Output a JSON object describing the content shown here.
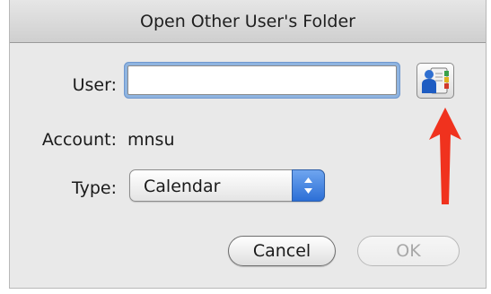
{
  "dialog": {
    "title": "Open Other User's Folder"
  },
  "form": {
    "user_label": "User:",
    "user_value": "",
    "account_label": "Account:",
    "account_value": "mnsu",
    "type_label": "Type:",
    "type_selected": "Calendar"
  },
  "buttons": {
    "cancel_label": "Cancel",
    "ok_label": "OK",
    "ok_enabled": false
  },
  "icons": {
    "pick_user": "address-book-person-icon",
    "select_stepper": "up-down-arrows-icon",
    "annotation": "red-arrow-up-icon"
  },
  "colors": {
    "annotation_arrow": "#f0321e",
    "focus_ring": "#8fb4e0",
    "stepper_blue": "#2c6fd6"
  }
}
